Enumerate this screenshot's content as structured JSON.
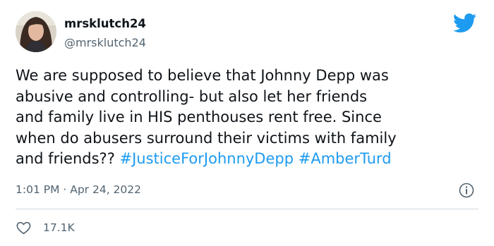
{
  "user": {
    "display_name": "mrsklutch24",
    "handle": "@mrsklutch24",
    "avatar_icon": "profile-photo"
  },
  "tweet": {
    "lines": [
      "We are supposed to believe that Johnny Depp was",
      "abusive and controlling- but also let her friends",
      "and family live in HIS penthouses rent free. Since",
      "when do abusers surround their victims with family"
    ],
    "last_line_text": "and friends?? ",
    "hashtags": [
      "#JusticeForJohnnyDepp",
      "#AmberTurd"
    ],
    "time": "1:01 PM · Apr 24, 2022"
  },
  "engagement": {
    "like_count": "17.1K"
  },
  "icons": {
    "brand": "twitter-bird-icon",
    "info": "info-icon",
    "like": "heart-icon"
  },
  "colors": {
    "brand": "#1d9bf0",
    "text": "#0f1419",
    "muted": "#536471"
  }
}
